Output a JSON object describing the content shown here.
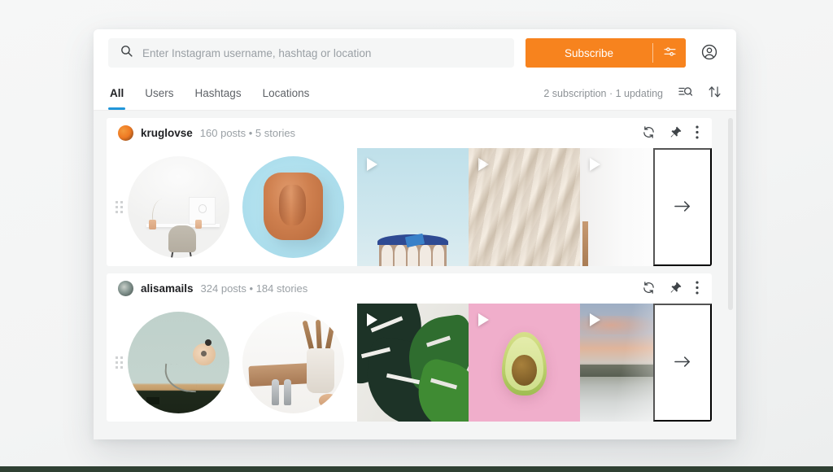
{
  "search": {
    "placeholder": "Enter Instagram username, hashtag or location",
    "value": "",
    "icon": "search-icon"
  },
  "header": {
    "subscribe_label": "Subscribe",
    "subscribe_color": "#f7831e",
    "options_icon": "sliders-icon",
    "account_icon": "user-circle-icon"
  },
  "tabs": {
    "active": "All",
    "active_color": "#2196d9",
    "items": [
      {
        "label": "All",
        "active": true
      },
      {
        "label": "Users",
        "active": false
      },
      {
        "label": "Hashtags",
        "active": false
      },
      {
        "label": "Locations",
        "active": false
      }
    ],
    "status": "2 subscription · 1 updating",
    "filter_icon": "filter-search-icon",
    "sort_icon": "sort-arrows-icon"
  },
  "cards": [
    {
      "username": "kruglovse",
      "stats": "160 posts  •  5 stories",
      "avatar": "avatar-kruglovse",
      "actions": {
        "refresh_icon": "refresh-icon",
        "pin_icon": "pin-icon",
        "more_icon": "more-vertical-icon"
      },
      "drag_handle_icon": "drag-handle-icon",
      "next_icon": "arrow-right-icon",
      "thumbnails": [
        {
          "name": "story-workspace-desk",
          "shape": "circle",
          "video": false
        },
        {
          "name": "story-copper-hat",
          "shape": "circle",
          "video": false
        },
        {
          "name": "post-blue-building",
          "shape": "square",
          "video": true
        },
        {
          "name": "post-sand-texture",
          "shape": "square",
          "video": true
        },
        {
          "name": "post-white-wall",
          "shape": "square",
          "video": true
        }
      ]
    },
    {
      "username": "alisamails",
      "stats": "324 posts  •  184 stories",
      "avatar": "avatar-alisamails",
      "actions": {
        "refresh_icon": "refresh-icon",
        "pin_icon": "pin-icon",
        "more_icon": "more-vertical-icon"
      },
      "drag_handle_icon": "drag-handle-icon",
      "next_icon": "arrow-right-icon",
      "thumbnails": [
        {
          "name": "story-mint-lamp",
          "shape": "circle",
          "video": false
        },
        {
          "name": "story-kitchen-utensils",
          "shape": "circle",
          "video": false
        },
        {
          "name": "post-monstera-leaves",
          "shape": "square",
          "video": true
        },
        {
          "name": "post-avocado-pink",
          "shape": "square",
          "video": true
        },
        {
          "name": "post-beach-sunset",
          "shape": "square",
          "video": true
        }
      ]
    }
  ]
}
